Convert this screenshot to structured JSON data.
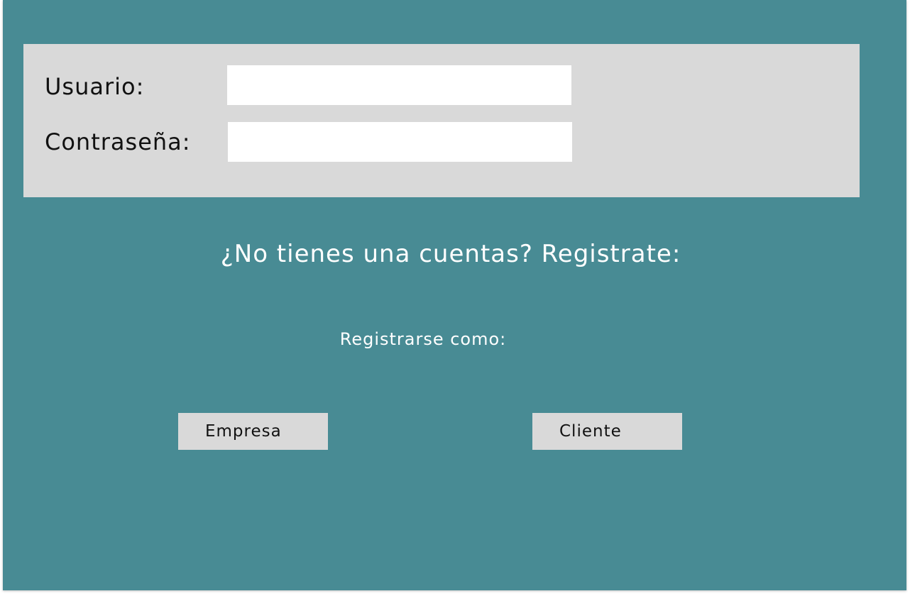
{
  "login": {
    "user_label": "Usuario:",
    "user_value": "",
    "password_label": "Contraseña:",
    "password_value": ""
  },
  "register": {
    "heading": "¿No tienes una cuentas? Registrate:",
    "subheading": "Registrarse como:",
    "company_button_label": "Empresa",
    "client_button_label": "Cliente"
  },
  "colors": {
    "background": "#488b94",
    "panel": "#d9d9d9",
    "input": "#ffffff",
    "heading_text": "#ffffff"
  }
}
